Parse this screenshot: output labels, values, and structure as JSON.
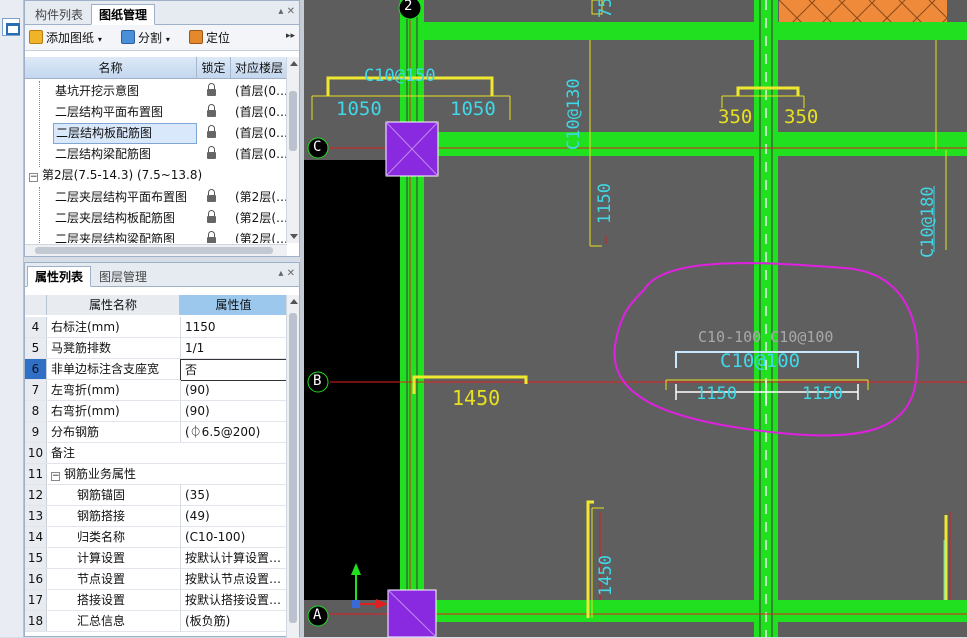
{
  "top_panel": {
    "tabs": [
      "构件列表",
      "图纸管理"
    ],
    "toolbar": {
      "add_drawing": "添加图纸",
      "split": "分割",
      "locate": "定位"
    },
    "columns": {
      "name": "名称",
      "lock": "锁定",
      "floor": "对应楼层"
    },
    "rows": [
      {
        "name": "基坑开挖示意图",
        "floor": "(首层(0…"
      },
      {
        "name": "二层结构平面布置图",
        "floor": "(首层(0…"
      },
      {
        "name": "二层结构板配筋图",
        "floor": "(首层(0…"
      },
      {
        "name": "二层结构梁配筋图",
        "floor": "(首层(0…"
      },
      {
        "name": "第2层(7.5-14.3) (7.5~13.8)",
        "group": true,
        "expander": "−"
      },
      {
        "name": "二层夹层结构平面布置图",
        "floor": "(第2层(…"
      },
      {
        "name": "二层夹层结构板配筋图",
        "floor": "(第2层(…"
      },
      {
        "name": "二层夹层结构梁配筋图",
        "floor": "(第2层(…"
      }
    ]
  },
  "bottom_panel": {
    "tabs": [
      "属性列表",
      "图层管理"
    ],
    "columns": {
      "name": "属性名称",
      "value": "属性值"
    },
    "rows": [
      {
        "num": "4",
        "name": "右标注(mm)",
        "value": "1150"
      },
      {
        "num": "5",
        "name": "马凳筋排数",
        "value": "1/1"
      },
      {
        "num": "6",
        "name": "非单边标注含支座宽",
        "value": "否"
      },
      {
        "num": "7",
        "name": "左弯折(mm)",
        "value": "(90)"
      },
      {
        "num": "8",
        "name": "右弯折(mm)",
        "value": "(90)"
      },
      {
        "num": "9",
        "name": "分布钢筋",
        "value": "(⏀6.5@200)"
      },
      {
        "num": "10",
        "name": "备注",
        "value": ""
      },
      {
        "num": "11",
        "name": "钢筋业务属性",
        "value": "",
        "group": true,
        "expander": "−"
      },
      {
        "num": "12",
        "name": "钢筋锚固",
        "value": "(35)",
        "indent": true
      },
      {
        "num": "13",
        "name": "钢筋搭接",
        "value": "(49)",
        "indent": true
      },
      {
        "num": "14",
        "name": "归类名称",
        "value": "(C10-100)",
        "indent": true
      },
      {
        "num": "15",
        "name": "计算设置",
        "value": "按默认计算设置…",
        "indent": true
      },
      {
        "num": "16",
        "name": "节点设置",
        "value": "按默认节点设置…",
        "indent": true
      },
      {
        "num": "17",
        "name": "搭接设置",
        "value": "按默认搭接设置…",
        "indent": true
      },
      {
        "num": "18",
        "name": "汇总信息",
        "value": "(板负筋)",
        "indent": true
      }
    ]
  },
  "cad": {
    "axis_labels": [
      "2",
      "C",
      "B",
      "A"
    ],
    "rebar_labels": [
      "C10@150",
      "C10@130",
      "C10@180",
      "C10-100 C10@100",
      "C10@100"
    ],
    "dimensions": [
      "1050",
      "1050",
      "350",
      "350",
      "1150",
      "1450",
      "1450",
      "1150",
      "1150",
      "75"
    ],
    "colors": {
      "background": "#5d5d5d",
      "beam": "#20e020",
      "dim_yellow": "#e8e020",
      "rebar_cyan": "#40d8e8",
      "axis_red": "#e02020",
      "column_fill": "#8a2ae0",
      "annotation_magenta": "#e020e0"
    }
  }
}
